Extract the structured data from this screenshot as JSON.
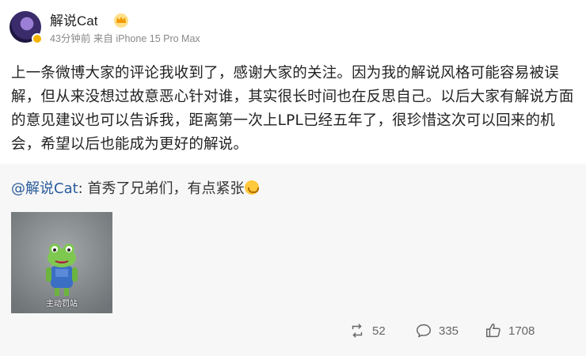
{
  "post": {
    "username": "解说Cat",
    "meta": "43分钟前 来自 iPhone 15 Pro Max",
    "content": "上一条微博大家的评论我收到了，感谢大家的关注。因为我的解说风格可能容易被误解，但从来没想过故意恶心针对谁，其实很长时间也在反思自己。以后大家有解说方面的意见建议也可以告诉我，距离第一次上LPL已经五年了，很珍惜这次可以回来的机会，希望以后也能成为更好的解说。"
  },
  "repost": {
    "mention": "@解说Cat",
    "text": ": 首秀了兄弟们，有点紧张",
    "image_caption": "主动罚站"
  },
  "actions": {
    "repost_count": "52",
    "comment_count": "335",
    "like_count": "1708"
  },
  "icons": {
    "avatar_badge": "verified-badge-icon",
    "crown": "crown-icon",
    "emoji": "nervous-emoji-icon",
    "repost": "repost-icon",
    "comment": "comment-icon",
    "like": "thumbs-up-icon"
  },
  "colors": {
    "mention": "#2a5b9b",
    "repost_bg": "#f7f7f7",
    "meta_text": "#888888"
  }
}
